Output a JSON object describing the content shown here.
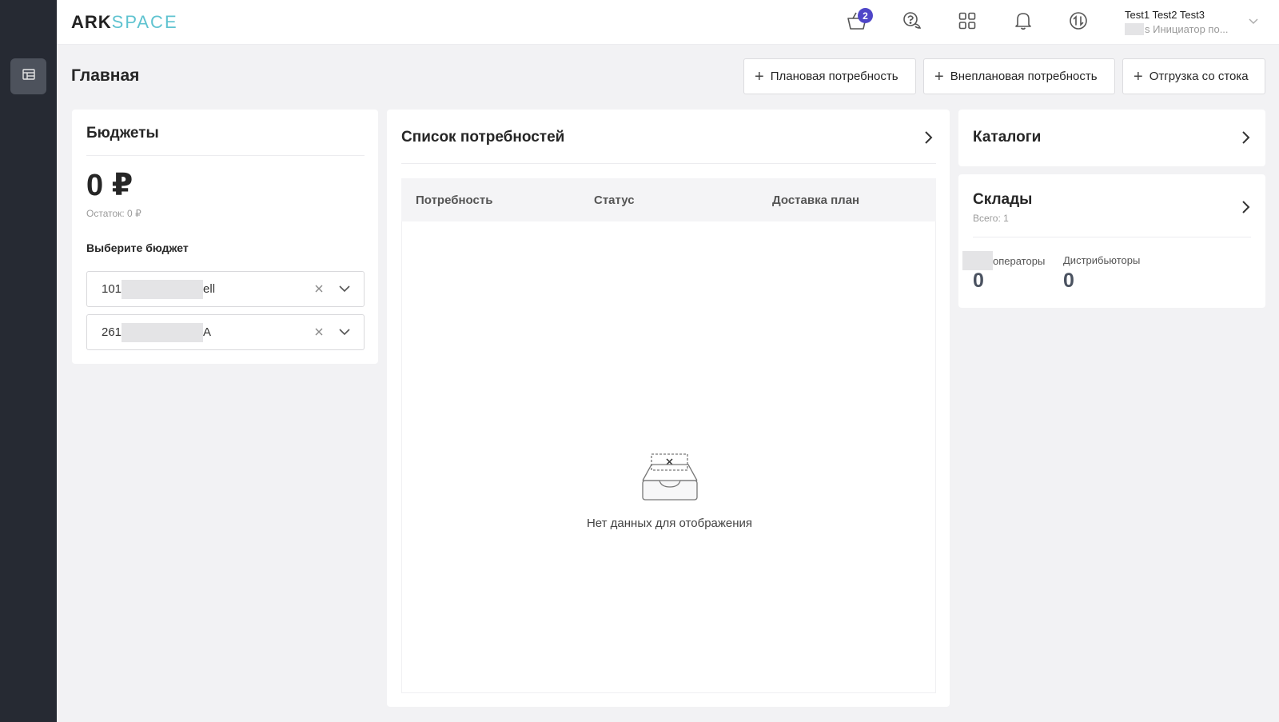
{
  "brand": {
    "part1": "ARK",
    "part2": "SPACE"
  },
  "header": {
    "cart_badge": "2",
    "user_name": "Test1 Test2 Test3",
    "user_role": "s Инициатор по..."
  },
  "sidebar": {
    "items": [
      {
        "icon": "table-icon"
      }
    ]
  },
  "page": {
    "title": "Главная",
    "actions": [
      {
        "label": "Плановая потребность"
      },
      {
        "label": "Внеплановая потребность"
      },
      {
        "label": "Отгрузка со стока"
      }
    ]
  },
  "budgets": {
    "title": "Бюджеты",
    "amount": "0 ₽",
    "remainder": "Остаток: 0 ₽",
    "choose_label": "Выберите бюджет",
    "selects": [
      {
        "prefix": "101",
        "suffix": "ell"
      },
      {
        "prefix": "261",
        "suffix": "A"
      }
    ]
  },
  "needs": {
    "title": "Список потребностей",
    "columns": [
      "Потребность",
      "Статус",
      "Доставка план"
    ],
    "empty_text": "Нет данных для отображения"
  },
  "catalogs": {
    "title": "Каталоги"
  },
  "warehouses": {
    "title": "Склады",
    "total": "Всего: 1",
    "stats": [
      {
        "label": "операторы",
        "value": "0"
      },
      {
        "label": "Дистрибьюторы",
        "value": "0"
      }
    ]
  },
  "colors": {
    "accent": "#4f46c8",
    "sidebar": "#262a33",
    "brand_space": "#5fc3d0"
  }
}
